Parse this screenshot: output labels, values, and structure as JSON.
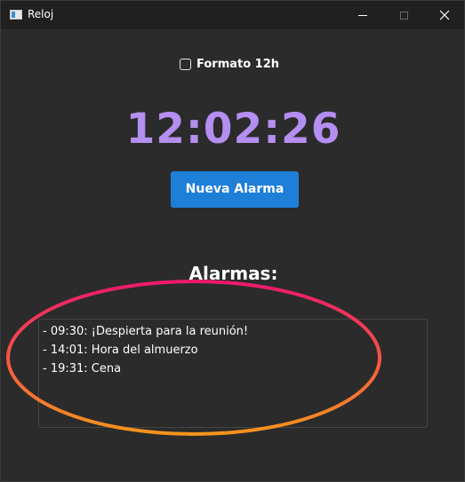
{
  "window": {
    "title": "Reloj",
    "controls": {
      "minimize_icon": "minimize-icon",
      "maximize_icon": "maximize-icon",
      "close_icon": "close-icon"
    }
  },
  "settings": {
    "format_12h_label": "Formato 12h",
    "format_12h_checked": false
  },
  "clock": {
    "time": "12:02:26",
    "color": "#b48ef0"
  },
  "actions": {
    "new_alarm_label": "Nueva Alarma"
  },
  "alarms": {
    "heading": "Alarmas:",
    "items": [
      "- 09:30: ¡Despierta para la reunión!",
      "- 14:01: Hora del almuerzo",
      "- 19:31: Cena"
    ]
  },
  "annotation": {
    "gradient_colors": [
      "#f0186e",
      "#f7941d"
    ]
  },
  "colors": {
    "accent": "#1e7fd8",
    "background": "#2b2b2b",
    "titlebar": "#202020"
  }
}
